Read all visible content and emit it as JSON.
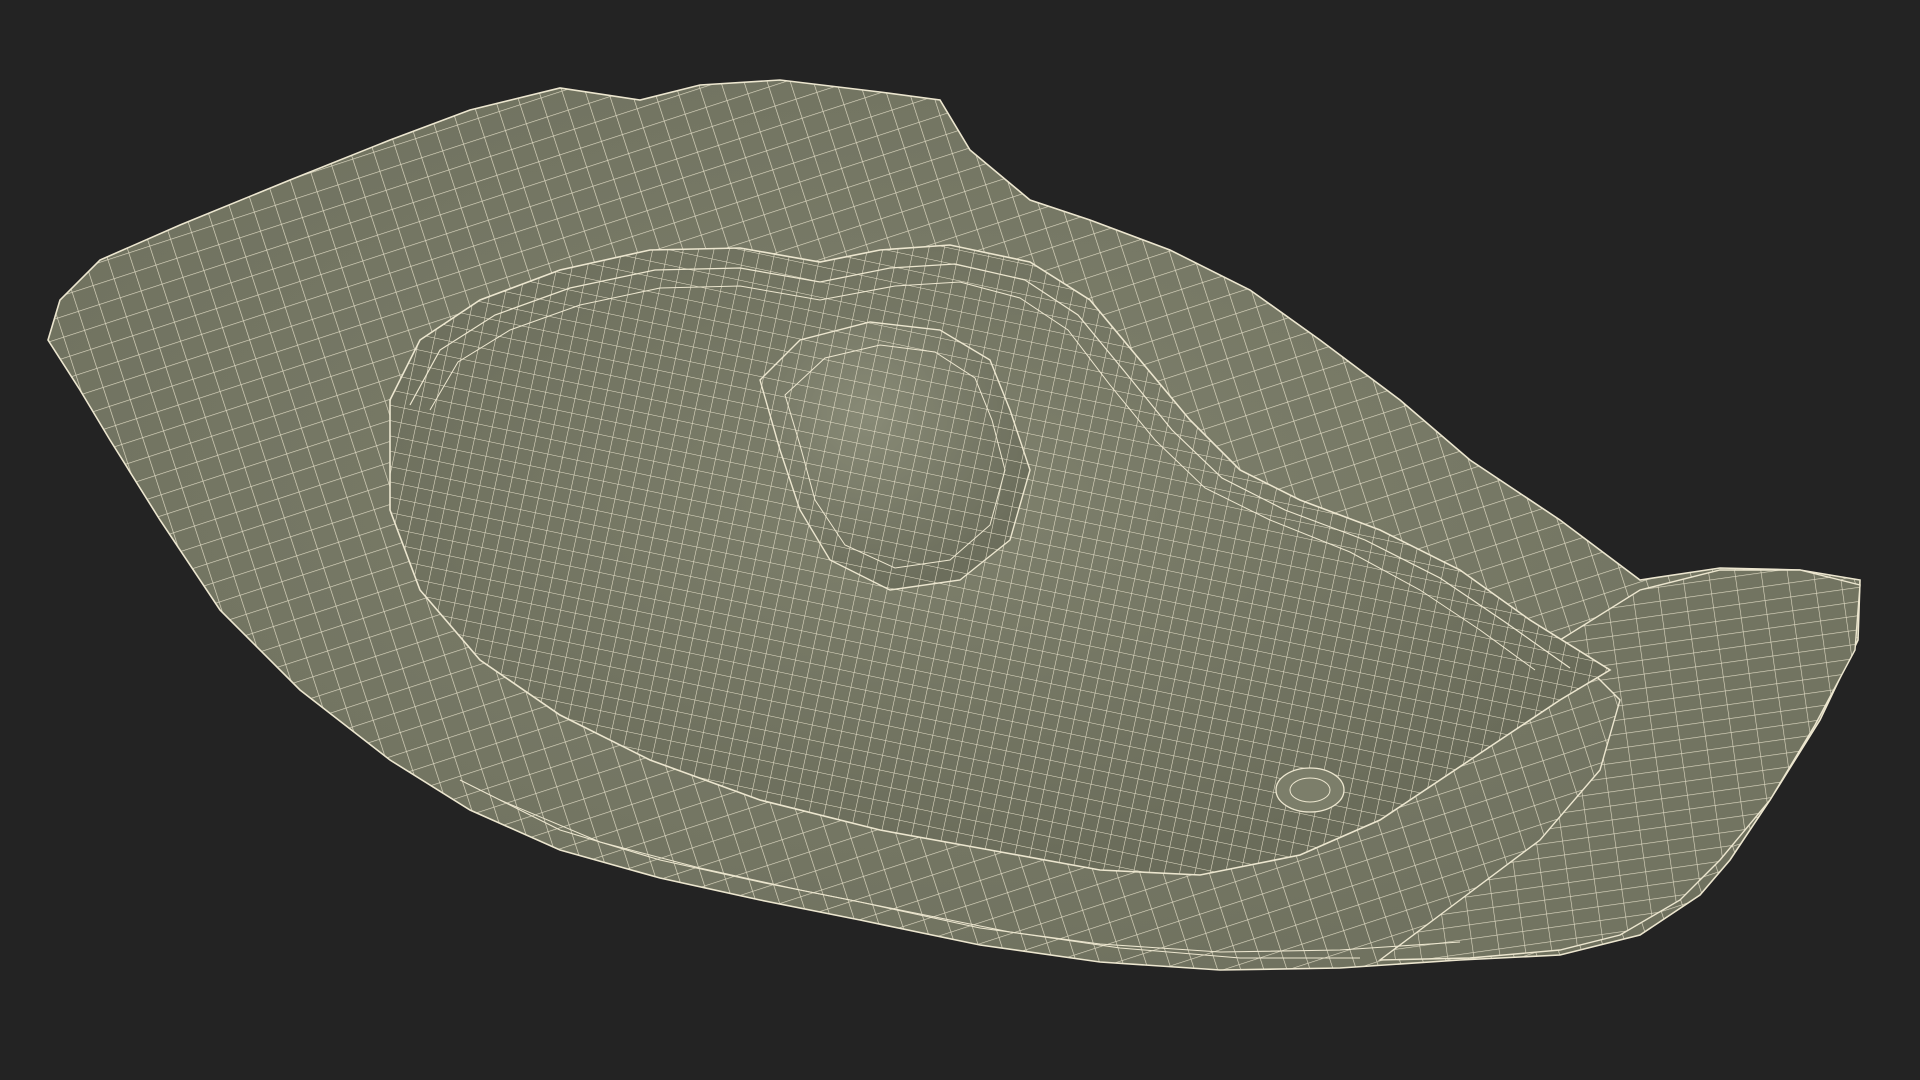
{
  "scene": {
    "subject": "wireframe-mesh-3d-model",
    "background_color": "#232323",
    "surface_color": "#787a67",
    "surface_shadow_color": "#686a58",
    "surface_highlight_color": "#8a8c78",
    "wire_color": "#ece6cf"
  }
}
